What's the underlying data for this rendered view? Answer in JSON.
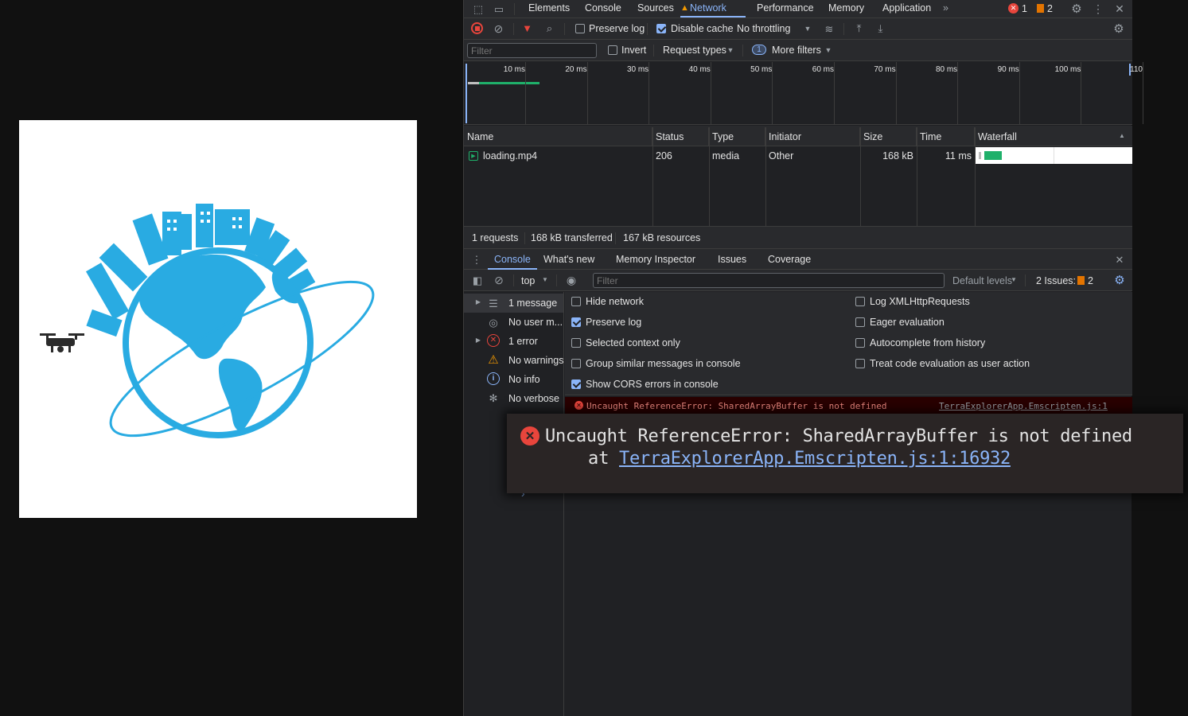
{
  "devtools_tabs": [
    "Elements",
    "Console",
    "Sources",
    "Network",
    "Performance",
    "Memory",
    "Application"
  ],
  "active_tab": "Network",
  "badges": {
    "errors": "1",
    "issues": "2"
  },
  "network_toolbar": {
    "preserve_log": "Preserve log",
    "disable_cache": "Disable cache",
    "throttling": "No throttling"
  },
  "filter_bar": {
    "placeholder": "Filter",
    "invert": "Invert",
    "request_types": "Request types",
    "filter_count": "1",
    "more_filters": "More filters"
  },
  "timeline_ticks": [
    "10 ms",
    "20 ms",
    "30 ms",
    "40 ms",
    "50 ms",
    "60 ms",
    "70 ms",
    "80 ms",
    "90 ms",
    "100 ms",
    "110"
  ],
  "table": {
    "headers": {
      "name": "Name",
      "status": "Status",
      "type": "Type",
      "initiator": "Initiator",
      "size": "Size",
      "time": "Time",
      "waterfall": "Waterfall"
    },
    "rows": [
      {
        "name": "loading.mp4",
        "status": "206",
        "type": "media",
        "initiator": "Other",
        "size": "168 kB",
        "time": "11 ms"
      }
    ]
  },
  "summary": {
    "requests": "1 requests",
    "transferred": "168 kB transferred",
    "resources": "167 kB resources"
  },
  "drawer_tabs": [
    "Console",
    "What's new",
    "Memory Inspector",
    "Issues",
    "Coverage"
  ],
  "console_toolbar": {
    "context": "top",
    "filter_placeholder": "Filter",
    "levels": "Default levels",
    "issues_label": "2 Issues:",
    "issues_count": "2"
  },
  "sidebar": [
    {
      "label": "1 message",
      "icon": "list-icon"
    },
    {
      "label": "No user m...",
      "icon": "user-icon"
    },
    {
      "label": "1 error",
      "icon": "error-icon"
    },
    {
      "label": "No warnings",
      "icon": "warning-icon"
    },
    {
      "label": "No info",
      "icon": "info-icon"
    },
    {
      "label": "No verbose",
      "icon": "bug-icon"
    }
  ],
  "settings_left": [
    {
      "label": "Hide network",
      "checked": false
    },
    {
      "label": "Preserve log",
      "checked": true
    },
    {
      "label": "Selected context only",
      "checked": false
    },
    {
      "label": "Group similar messages in console",
      "checked": false
    },
    {
      "label": "Show CORS errors in console",
      "checked": true
    }
  ],
  "settings_right": [
    {
      "label": "Log XMLHttpRequests",
      "checked": false
    },
    {
      "label": "Eager evaluation",
      "checked": false
    },
    {
      "label": "Autocomplete from history",
      "checked": false
    },
    {
      "label": "Treat code evaluation as user action",
      "checked": false
    }
  ],
  "error_line": {
    "message": "Uncaught ReferenceError: SharedArrayBuffer is not defined",
    "source": "TerraExplorerApp.Emscripten.js:1"
  },
  "zoomed_error": {
    "message": "Uncaught ReferenceError: SharedArrayBuffer is not defined",
    "at": "at",
    "link": "TerraExplorerApp.Emscripten.js:1:16932"
  },
  "colors": {
    "accent": "#8ab4f8",
    "error": "#f28b82",
    "globe": "#29abe2",
    "waterfall": "#1fb06a"
  }
}
